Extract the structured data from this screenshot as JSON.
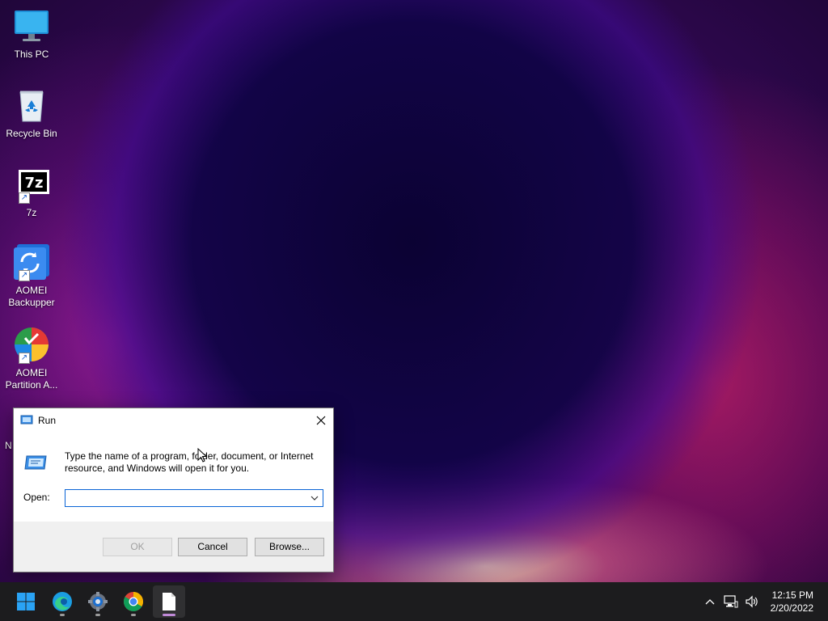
{
  "desktop": {
    "icons": [
      {
        "label": "This PC",
        "icon": "monitor-icon"
      },
      {
        "label": "Recycle Bin",
        "icon": "recycle-bin-icon"
      },
      {
        "label": "7z",
        "icon": "7zip-icon",
        "glyph": "7z"
      },
      {
        "label": "AOMEI Backupper",
        "icon": "aomei-backupper-icon"
      },
      {
        "label": "AOMEI Partition A...",
        "icon": "aomei-partition-icon"
      },
      {
        "label": "N",
        "icon": "keyboard-icon"
      }
    ]
  },
  "run_dialog": {
    "title": "Run",
    "description": "Type the name of a program, folder, document, or Internet resource, and Windows will open it for you.",
    "open_label": "Open:",
    "input_value": "",
    "ok_label": "OK",
    "cancel_label": "Cancel",
    "browse_label": "Browse...",
    "ok_enabled": false
  },
  "taskbar": {
    "apps": [
      {
        "name": "start",
        "icon": "windows-logo-icon"
      },
      {
        "name": "edge",
        "icon": "edge-icon"
      },
      {
        "name": "settings",
        "icon": "settings-gear-icon"
      },
      {
        "name": "chrome",
        "icon": "chrome-icon"
      },
      {
        "name": "run",
        "icon": "document-icon",
        "active": true
      }
    ],
    "tray": [
      "chevron-up-icon",
      "network-icon",
      "volume-icon"
    ],
    "time": "12:15 PM",
    "date": "2/20/2022"
  },
  "colors": {
    "accent": "#0a64d6",
    "taskbar": "#1c1c1e",
    "dialog_bg": "#f0f0f0"
  }
}
